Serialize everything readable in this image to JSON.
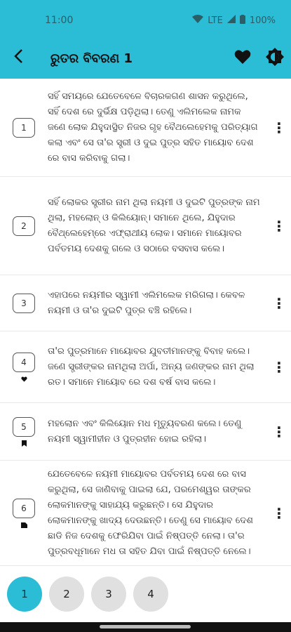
{
  "status": {
    "time": "11:00",
    "network": "LTE",
    "battery": "100%"
  },
  "appbar": {
    "title": "ରୁତର ବିବରଣ 1"
  },
  "verses": [
    {
      "number": "1",
      "mark": "",
      "text": "ସହିଁ ସମୟରେ ଯେତେବେଳେ ବିଚାରକଗଣ ଶାସନ କରୁଥିଲେ, ସହିଁ ଦେଶ ରେ ଦୁର୍ଭିକ୍ଷ ପଡ଼ିଥିଲା। ତେଣୁ ଏଲିମଲେକ ନାମକ ଜଣେ ଲୋକ ଯିହୁଦାସ୍ଥିତ ନିଜର ଗୃହ ବୈଥଲେହେମକୁ ପରିତ୍ୟାଗ କଲା ଏବଂ ସେ ତା'ର ସ୍ତ୍ରୀ ଓ ଦୁଇ ପୁତ୍ର ସହିତ ମାୟୋବ ଦେଶ ରେ ବାସ କରିବାକୁ ଗଲା।"
    },
    {
      "number": "2",
      "mark": "",
      "text": "ସହିଁ ଲୋକର ସ୍ତ୍ରୀର ନାମ ଥିଲା ନୟମୀ ଓ ଦୁଇଟି ପୁତ୍ରଙ୍କ ନାମ ଥିଲା, ମହଲୋନ୍ ଓ କିଲିୟୋନ୍। ସମାନେ ଥିଲେ, ଯିହୁଦାର ବୈଥ୍ଲେହେମ୍ରେ ଏଫ୍ରାଥୀୟ ଲୋକ। ସମାନେ ମାୟୋବର ପର୍ବତମୟ ଦେଶକୁ ଗଲେ ଓ ସଠାରେ ବସବାସ କଲେ।"
    },
    {
      "number": "3",
      "mark": "",
      "text": "ଏହାପରେ ନୟମୀର ସ୍ୱାମୀ ଏଲିମଲେକ ମରିଗଲା। କେବଳ ନୟମୀ ଓ ତା'ର ଦୁଇଟି ପୁତ୍ର ବଞ୍ଚି ରହିଲେ।"
    },
    {
      "number": "4",
      "mark": "heart",
      "text": "ତା'ର ପୁତ୍ରମାନେ ମାୟୋବର ଯୁବତୀମାନଙ୍କୁ ବିବାହ କଲେ। ଜଣେ ସ୍ତ୍ରୀଙ୍କର ନାମଥିଲା ଅର୍ପା, ଅନ୍ୟ ଜଣଙ୍କର ନାମ ଥିଲା ରତ। ସମାନେ ମାୟୋବ ରେ ଦଶ ବର୍ଷ ବାସ କଲେ।"
    },
    {
      "number": "5",
      "mark": "bookmark",
      "text": "ମହଲୋନ ଏବଂ କିଲିୟୋନ ମଧ ମୃତ୍ୟୁବରଣ କଲେ। ତେଣୁ ନୟମୀ ସ୍ୱାମୀହୀନ ଓ ପୁତ୍ରହୀନ ହୋଇ ରହିଲା।"
    },
    {
      "number": "6",
      "mark": "note",
      "text": "ଯେତେବେଳେ ନୟମୀ ମାୟୋବର ପର୍ବତମୟ ଦେଶ ରେ ବାସ କରୁଥିଲା, ସେ ଜାଣିବାକୁ ପାଇଲା ଯେ, ପରମେଶ୍ୱର ତାଙ୍କର ଲୋକମାନଙ୍କୁ ସାହାଯ୍ୟ କରୁଛନ୍ତି। ସେ ଯିହୁଦାର ଲୋକମାନଙ୍କୁ ଖାଦ୍ୟ ଦେଉଛନ୍ତି। ତେଣୁ ସେ ମାୟୋବ ଦେଶ ଛାଡି ନିଜ ଦେଶକୁ ଫେରିଯିବା ପାଇଁ ନିଷ୍ପତ୍ତି ନେଲା। ତା'ର ପୁତ୍ରବଧୂମାନେ ମଧ ତା ସହିତ ଯିବା ପାଇଁ ନିଷ୍ପତ୍ତି ନେଲେ।"
    }
  ],
  "pager": {
    "pages": [
      "1",
      "2",
      "3",
      "4"
    ],
    "active": "1"
  },
  "colors": {
    "accent": "#2bbcd6"
  },
  "icons": {
    "back": "arrow-back-icon",
    "favorite": "heart-icon",
    "theme": "brightness-icon",
    "menu": "more-vert-icon"
  }
}
